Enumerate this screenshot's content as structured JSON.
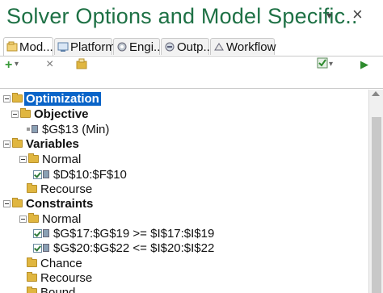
{
  "pane": {
    "title": "Solver Options and Model Specific..",
    "menu_glyph": "▼",
    "close_glyph": "×"
  },
  "tabs": [
    {
      "label": "Mod...",
      "icon": "model-icon",
      "active": true
    },
    {
      "label": "Platform",
      "icon": "platform-icon",
      "active": false
    },
    {
      "label": "Engi...",
      "icon": "engine-icon",
      "active": false
    },
    {
      "label": "Outp...",
      "icon": "output-icon",
      "active": false
    },
    {
      "label": "Workflow",
      "icon": "workflow-icon",
      "active": false
    }
  ],
  "toolbar": {
    "add_glyph": "+",
    "dropdown_glyph": "▾",
    "delete_glyph": "×",
    "run_glyph": "▶",
    "colors": {
      "add": "#3a9a3a",
      "run": "#2e8b2e"
    }
  },
  "tree": {
    "root": "Optimization",
    "objective": {
      "label": "Objective",
      "items": [
        "$G$13 (Min)"
      ]
    },
    "variables": {
      "label": "Variables",
      "normal": {
        "label": "Normal",
        "items": [
          "$D$10:$F$10"
        ]
      },
      "recourse": "Recourse"
    },
    "constraints": {
      "label": "Constraints",
      "normal": {
        "label": "Normal",
        "items": [
          "$G$17:$G$19 >= $I$17:$I$19",
          "$G$20:$G$22 <= $I$20:$I$22"
        ]
      },
      "chance": "Chance",
      "recourse": "Recourse",
      "bound": "Bound"
    }
  },
  "colors": {
    "title": "#1e7145",
    "selection": "#0a64c8",
    "folder": "#e0b640"
  }
}
